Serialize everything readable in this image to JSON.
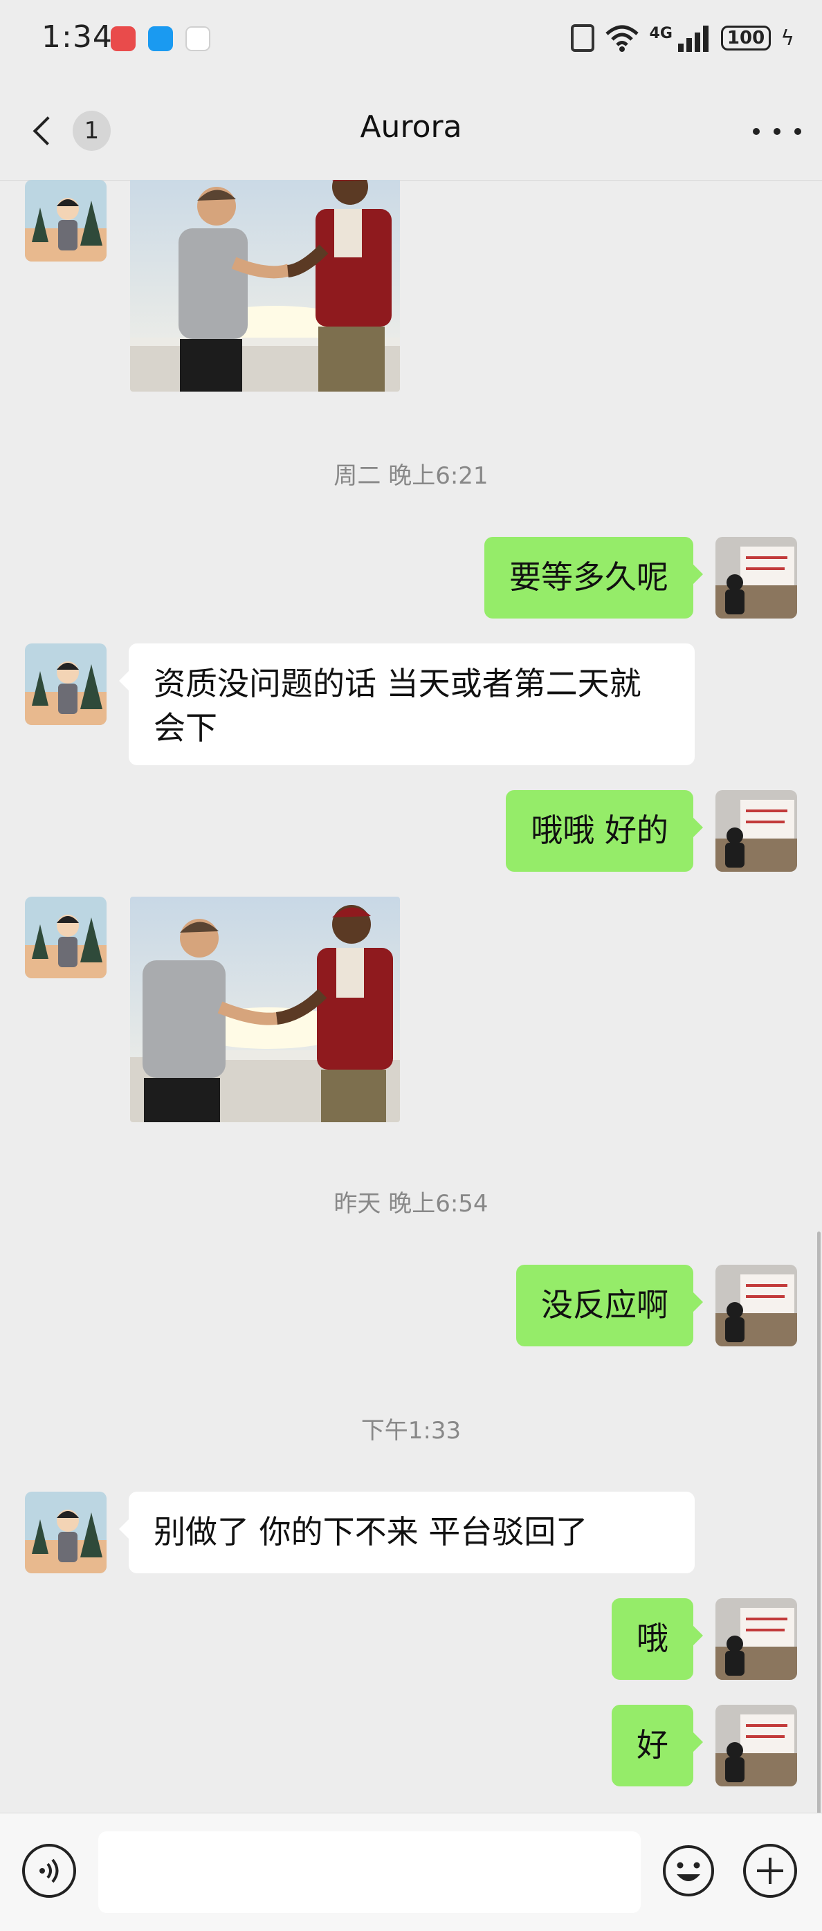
{
  "status_bar": {
    "time": "1:34",
    "network": "4G",
    "battery": "100",
    "apps": [
      "huawei-store-icon",
      "message-app-icon",
      "mobile-carrier-icon"
    ]
  },
  "header": {
    "unread_count": "1",
    "title": "Aurora"
  },
  "messages": [
    {
      "type": "image",
      "side": "left",
      "image": "two-men-handshake-photo"
    },
    {
      "type": "time",
      "text": "周二 晚上6:21"
    },
    {
      "type": "text",
      "side": "right",
      "text": "要等多久呢"
    },
    {
      "type": "text",
      "side": "left",
      "text": "资质没问题的话  当天或者第二天就会下"
    },
    {
      "type": "text",
      "side": "right",
      "text": "哦哦   好的"
    },
    {
      "type": "image",
      "side": "left",
      "image": "two-men-handshake-photo"
    },
    {
      "type": "time",
      "text": "昨天 晚上6:54"
    },
    {
      "type": "text",
      "side": "right",
      "text": "没反应啊"
    },
    {
      "type": "time",
      "text": "下午1:33"
    },
    {
      "type": "text",
      "side": "left",
      "text": "别做了   你的下不来   平台驳回了"
    },
    {
      "type": "text",
      "side": "right",
      "text": "哦"
    },
    {
      "type": "text",
      "side": "right",
      "text": "好"
    }
  ],
  "input_bar": {
    "placeholder": "",
    "value": ""
  },
  "colors": {
    "background": "#ededed",
    "sent_bubble": "#95ec69",
    "received_bubble": "#ffffff",
    "timestamp_text": "#888888"
  }
}
